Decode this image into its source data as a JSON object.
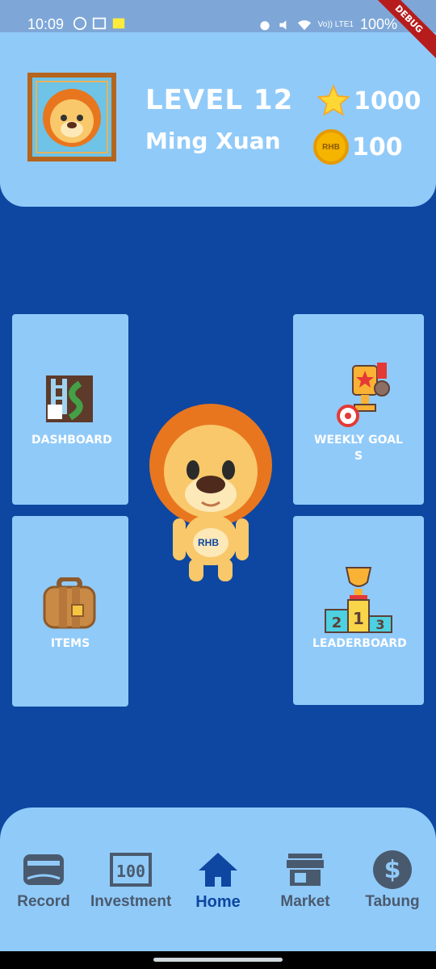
{
  "status_bar": {
    "time": "10:09",
    "battery": "100%",
    "network": "Vo)) LTE1"
  },
  "debug_banner": "DEBUG",
  "header": {
    "level_text": "LEVEL 12",
    "player_name": "Ming Xuan",
    "stars": "1000",
    "coins": "100",
    "coin_label": "RHB"
  },
  "cards": {
    "dashboard": "DASHBOARD",
    "weekly_goals": "WEEKLY GOALS",
    "items": "ITEMS",
    "leaderboard": "LEADERBOARD"
  },
  "mascot_badge": "RHB",
  "nav": {
    "items": [
      {
        "label": "Record",
        "icon": "wallet-icon"
      },
      {
        "label": "Investment",
        "icon": "cash-100-icon"
      },
      {
        "label": "Home",
        "icon": "home-icon"
      },
      {
        "label": "Market",
        "icon": "store-icon"
      },
      {
        "label": "Tabung",
        "icon": "dollar-circle-icon"
      }
    ],
    "active": "Home"
  },
  "colors": {
    "background": "#0d47a1",
    "panel": "#90caf9",
    "nav_inactive": "#4a5a6e",
    "nav_active": "#0d47a1"
  }
}
